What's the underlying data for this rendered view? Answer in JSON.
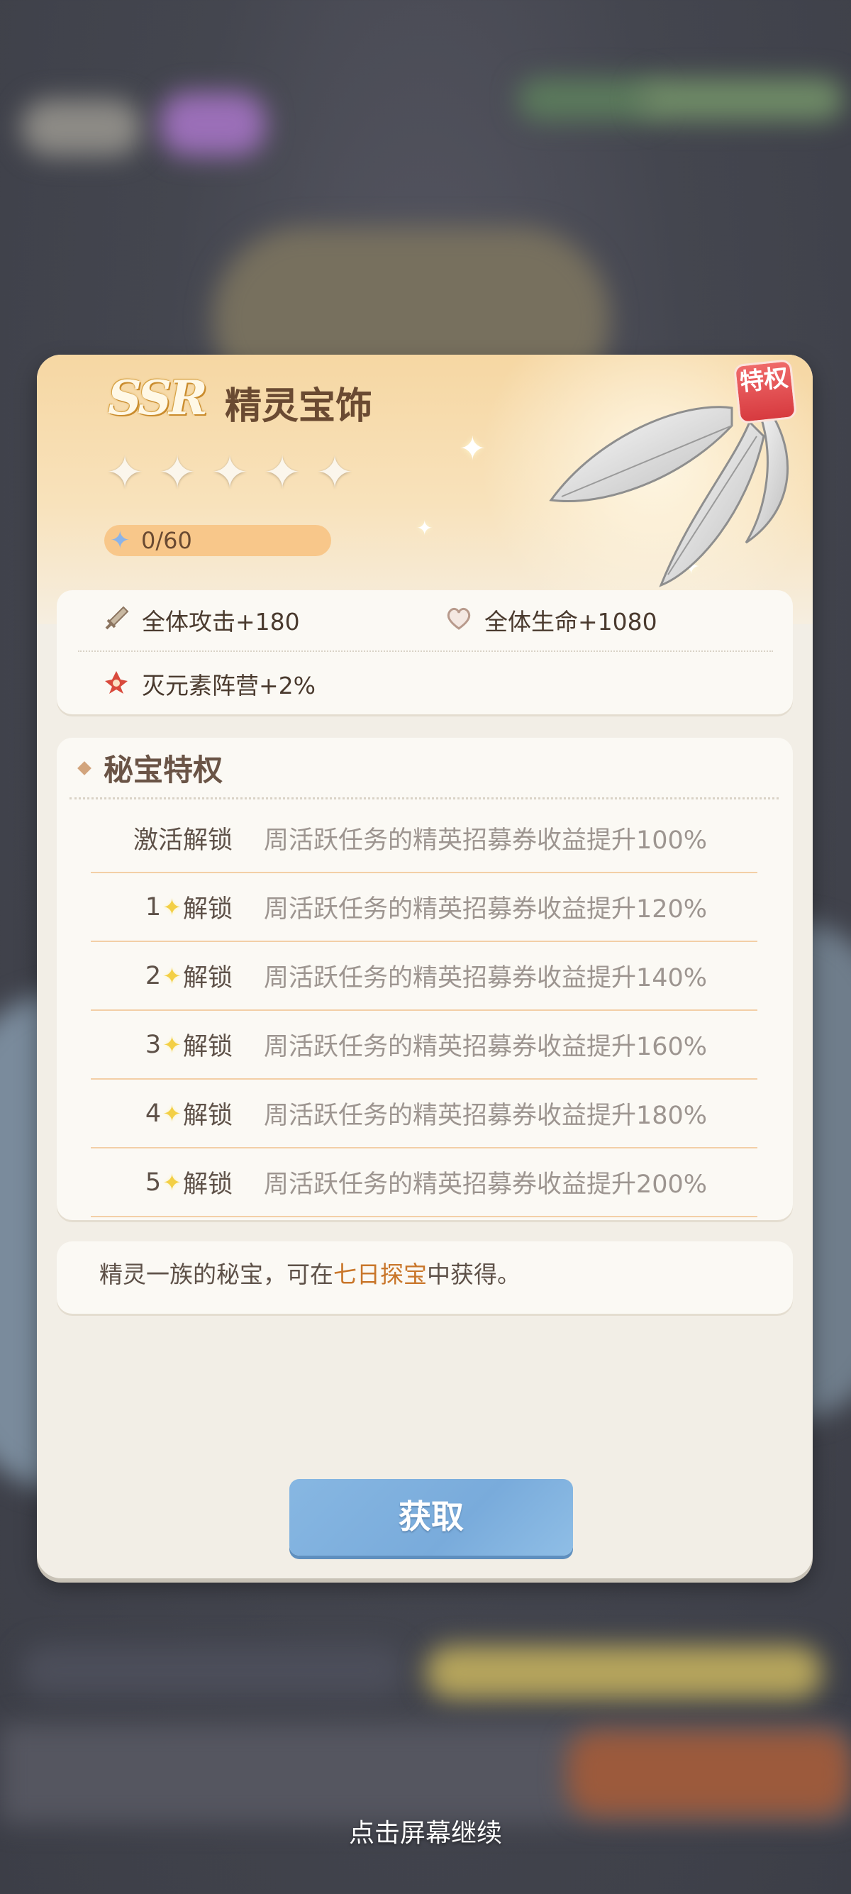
{
  "item": {
    "rarity": "SSR",
    "name": "精灵宝饰",
    "tag": "特权",
    "star_count": 5,
    "progress_text": "0/60",
    "progress_fraction": 0
  },
  "stats": {
    "attack": "全体攻击+180",
    "hp": "全体生命+1080",
    "faction": "灭元素阵营+2%"
  },
  "privilege": {
    "title": "秘宝特权",
    "rows": [
      {
        "level": "",
        "unlock": "激活解锁",
        "desc": "周活跃任务的精英招募券收益提升100%"
      },
      {
        "level": "1",
        "unlock": "解锁",
        "desc": "周活跃任务的精英招募券收益提升120%"
      },
      {
        "level": "2",
        "unlock": "解锁",
        "desc": "周活跃任务的精英招募券收益提升140%"
      },
      {
        "level": "3",
        "unlock": "解锁",
        "desc": "周活跃任务的精英招募券收益提升160%"
      },
      {
        "level": "4",
        "unlock": "解锁",
        "desc": "周活跃任务的精英招募券收益提升180%"
      },
      {
        "level": "5",
        "unlock": "解锁",
        "desc": "周活跃任务的精英招募券收益提升200%"
      }
    ]
  },
  "source": {
    "prefix": "精灵一族的秘宝，可在",
    "highlight": "七日探宝",
    "suffix": "中获得。"
  },
  "button": {
    "get": "获取"
  },
  "footer": {
    "continue": "点击屏幕继续"
  },
  "colors": {
    "header": "#f6d7a3",
    "highlight": "#c9762a",
    "button": "#87b7e2",
    "tag": "#d73a3f",
    "unlock_star": "#f3cf45"
  },
  "icons": {
    "attack": "sword-icon",
    "hp": "heart-icon",
    "faction": "faction-emblem-icon",
    "star": "star-icon",
    "progress": "puzzle-star-icon"
  }
}
